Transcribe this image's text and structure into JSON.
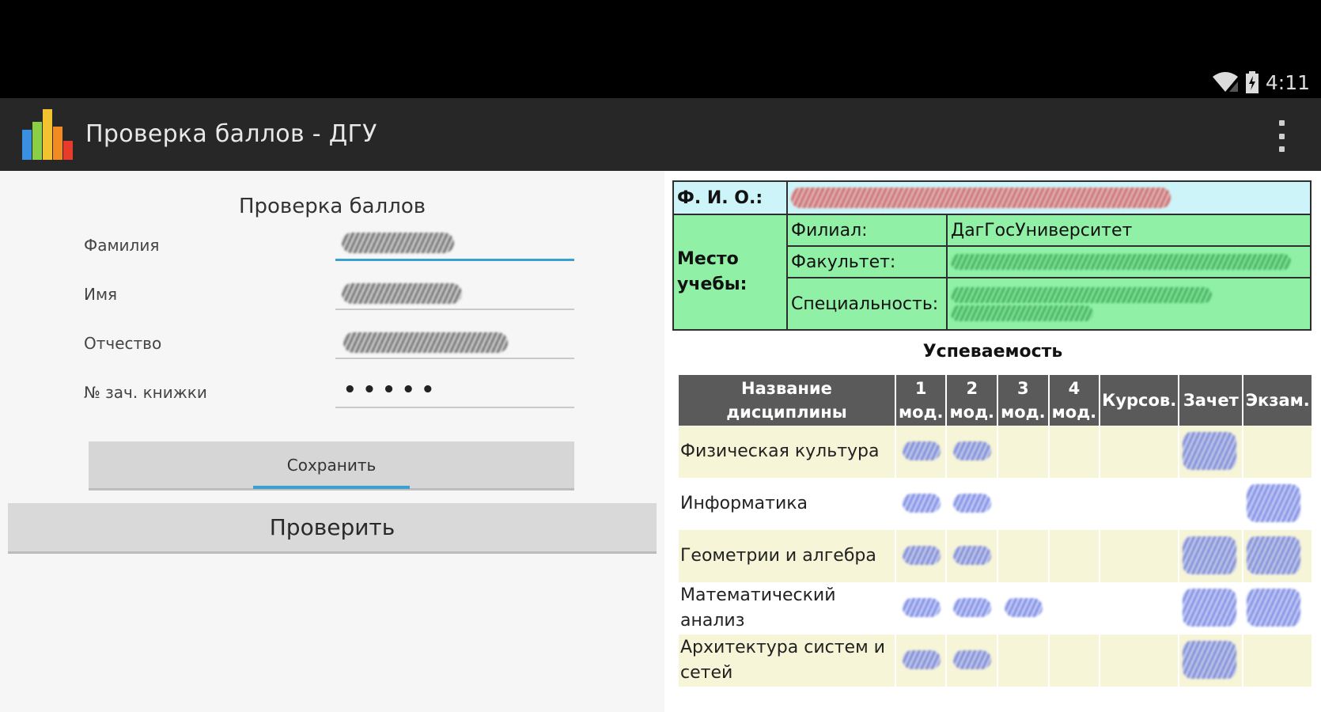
{
  "status_bar": {
    "time": "4:11"
  },
  "app_bar": {
    "title": "Проверка баллов - ДГУ",
    "icon": "bar-chart-app-icon"
  },
  "form": {
    "title": "Проверка баллов",
    "fields": [
      {
        "label": "Фамилия",
        "value": ""
      },
      {
        "label": "Имя",
        "value": ""
      },
      {
        "label": "Отчество",
        "value": ""
      },
      {
        "label": "№ зач. книжки",
        "value": "•••••"
      }
    ],
    "save_label": "Сохранить",
    "check_label": "Проверить"
  },
  "student": {
    "fio_label": "Ф. И. О.:",
    "place_label": "Место учебы:",
    "branch_label": "Филиал:",
    "branch_value": "ДагГосУниверситет",
    "faculty_label": "Факультет:",
    "specialty_label": "Специальность:"
  },
  "grades": {
    "title": "Успеваемость",
    "columns": [
      "Название дисциплины",
      "1 мод.",
      "2 мод.",
      "3 мод.",
      "4 мод.",
      "Курсов.",
      "Зачет",
      "Экзам."
    ],
    "rows": [
      {
        "name": "Физическая культура",
        "marks": [
          true,
          true,
          false,
          false,
          false,
          true,
          false
        ]
      },
      {
        "name": "Информатика",
        "marks": [
          true,
          true,
          false,
          false,
          false,
          false,
          true
        ]
      },
      {
        "name": "Геометрии и алгебра",
        "marks": [
          true,
          true,
          false,
          false,
          false,
          true,
          true
        ]
      },
      {
        "name": "Математический анализ",
        "marks": [
          true,
          true,
          true,
          false,
          false,
          true,
          true
        ]
      },
      {
        "name": "Архитектура систем и сетей",
        "marks": [
          true,
          true,
          false,
          false,
          false,
          true,
          false
        ]
      }
    ]
  },
  "colors": {
    "status_bar": "#000000",
    "action_bar": "#272727",
    "accent": "#3aa0d2",
    "fio_row": "#cdf4f8",
    "place_rows": "#8ff0a6",
    "header_row": "#5a5a5a",
    "odd_row": "#f7f5d8"
  }
}
